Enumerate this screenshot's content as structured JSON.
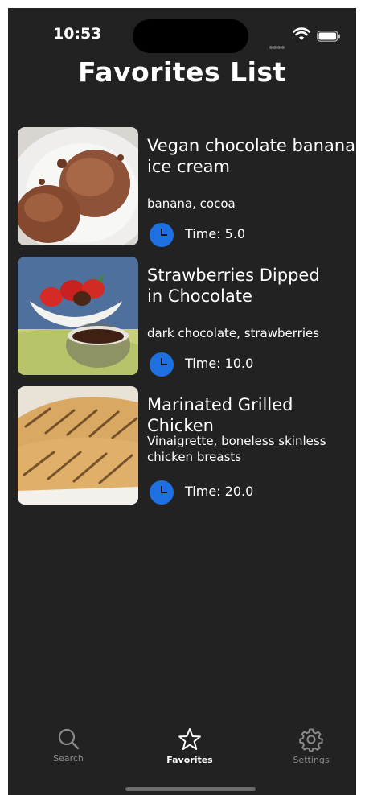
{
  "status_bar": {
    "time": "10:53"
  },
  "page": {
    "title": "Favorites List"
  },
  "recipes": [
    {
      "name": "Vegan chocolate banana\nice cream",
      "ingredients": "banana, cocoa",
      "time_label": "Time: 5.0",
      "image": "chocolate-ice-cream-photo"
    },
    {
      "name": "Strawberries Dipped\nin Chocolate",
      "ingredients": "dark chocolate, strawberries",
      "time_label": "Time: 10.0",
      "image": "strawberries-chocolate-photo"
    },
    {
      "name": "Marinated Grilled Chicken",
      "ingredients": "Vinaigrette, boneless skinless chicken breasts",
      "time_label": "Time: 20.0",
      "image": "grilled-chicken-photo"
    }
  ],
  "tab_bar": {
    "tabs": [
      {
        "label": "Search",
        "icon": "search-icon",
        "active": false
      },
      {
        "label": "Favorites",
        "icon": "star-icon",
        "active": true
      },
      {
        "label": "Settings",
        "icon": "gear-icon",
        "active": false
      }
    ]
  },
  "colors": {
    "background": "#222222",
    "clock_accent": "#1e6fe0",
    "inactive_tab": "#8a8a8a"
  }
}
